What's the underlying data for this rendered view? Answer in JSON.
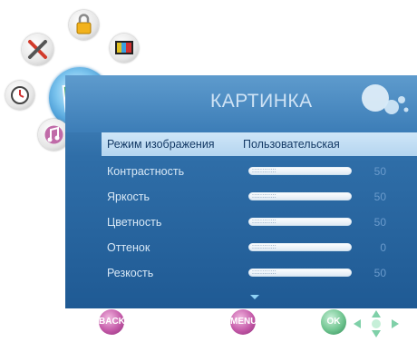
{
  "menu": {
    "title": "КАРТИНКА",
    "picture_mode": {
      "label": "Режим изображения",
      "value": "Пользовательская"
    },
    "settings": [
      {
        "label": "Контрастность",
        "value": "50",
        "level": 0.5
      },
      {
        "label": "Яркость",
        "value": "50",
        "level": 0.5
      },
      {
        "label": "Цветность",
        "value": "50",
        "level": 0.5
      },
      {
        "label": "Оттенок",
        "value": "0",
        "level": 0.5
      },
      {
        "label": "Резкость",
        "value": "50",
        "level": 0.5
      }
    ]
  },
  "buttons": {
    "back": "BACK",
    "menu": "MENU",
    "ok": "OK"
  },
  "categories": [
    "lock-icon",
    "tools-icon",
    "tv-icon",
    "picture-icon",
    "timer-icon",
    "music-icon"
  ],
  "colors": {
    "panel": "#2f6ea8",
    "highlight": "#c3def3",
    "value_text": "#6b9bcc",
    "back_menu_button": "#c45aa8",
    "ok_button": "#6fc48f"
  }
}
